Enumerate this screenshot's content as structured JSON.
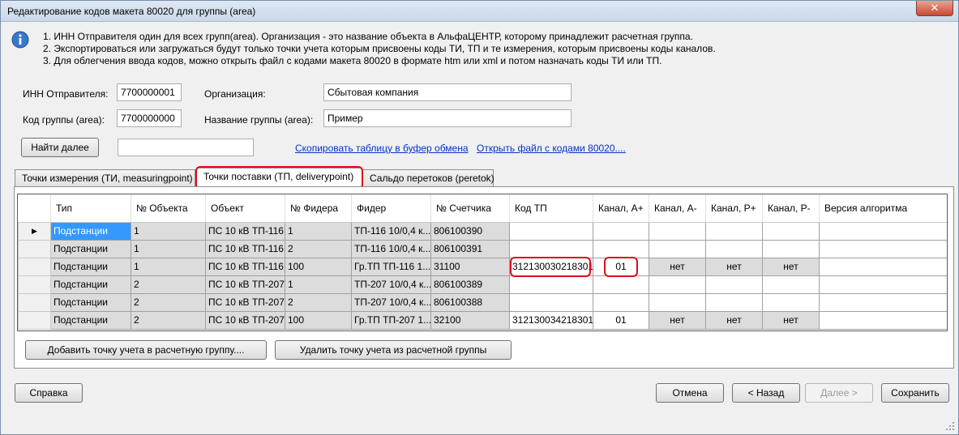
{
  "window": {
    "title": "Редактирование кодов макета 80020 для группы (area)",
    "close_label": "✕"
  },
  "info": {
    "lines": [
      "1. ИНН Отправителя один для всех групп(area). Организация - это название объекта в АльфаЦЕНТР, которому принадлежит расчетная группа.",
      "2. Экспортироваться или загружаться будут только точки учета которым присвоены коды ТИ, ТП и те измерения, которым присвоены коды каналов.",
      "3. Для облегчения ввода кодов, можно открыть файл с кодами макета 80020 в формате htm или xml и потом назначать коды ТИ или ТП."
    ]
  },
  "form": {
    "inn_label": "ИНН Отправителя:",
    "inn_value": "7700000001",
    "org_label": "Организация:",
    "org_value": "Сбытовая компания",
    "group_code_label": "Код группы (area):",
    "group_code_value": "7700000000",
    "group_name_label": "Название группы (area):",
    "group_name_value": "Пример",
    "find_next_label": "Найти далее",
    "search_value": "",
    "copy_link": "Скопировать таблицу в буфер обмена",
    "open_link": "Открыть файл с кодами 80020...."
  },
  "tabs": [
    {
      "label": "Точки измерения (ТИ, measuringpoint)",
      "active": false
    },
    {
      "label": "Точки поставки (ТП, deliverypoint)",
      "active": true
    },
    {
      "label": "Сальдо перетоков (peretok)",
      "active": false
    }
  ],
  "grid": {
    "columns": [
      "Тип",
      "№ Объекта",
      "Объект",
      "№ Фидера",
      "Фидер",
      "№ Счетчика",
      "Код ТП",
      "Канал, А+",
      "Канал, А-",
      "Канал, Р+",
      "Канал, Р-",
      "Версия алгоритма"
    ],
    "current_row_marker": "▶",
    "rows": [
      [
        "Подстанции",
        "1",
        "ПС 10 кВ ТП-116",
        "1",
        "ТП-116 10/0,4 к...",
        "806100390",
        "",
        "",
        "",
        "",
        "",
        ""
      ],
      [
        "Подстанции",
        "1",
        "ПС 10 кВ ТП-116",
        "2",
        "ТП-116 10/0,4 к...",
        "806100391",
        "",
        "",
        "",
        "",
        "",
        ""
      ],
      [
        "Подстанции",
        "1",
        "ПС 10 кВ ТП-116",
        "100",
        "Гр.ТП ТП-116 1...",
        "31100",
        "312130030218301",
        "01",
        "нет",
        "нет",
        "нет",
        ""
      ],
      [
        "Подстанции",
        "2",
        "ПС 10 кВ ТП-207",
        "1",
        "ТП-207 10/0,4 к...",
        "806100389",
        "",
        "",
        "",
        "",
        "",
        ""
      ],
      [
        "Подстанции",
        "2",
        "ПС 10 кВ ТП-207",
        "2",
        "ТП-207 10/0,4 к...",
        "806100388",
        "",
        "",
        "",
        "",
        "",
        ""
      ],
      [
        "Подстанции",
        "2",
        "ПС 10 кВ ТП-207",
        "100",
        "Гр.ТП ТП-207 1...",
        "32100",
        "312130034218301",
        "01",
        "нет",
        "нет",
        "нет",
        ""
      ]
    ]
  },
  "actions": {
    "add_point": "Добавить точку учета в расчетную группу....",
    "remove_point": "Удалить точку учета из расчетной группы"
  },
  "footer": {
    "help": "Справка",
    "cancel": "Отмена",
    "back": "< Назад",
    "next": "Далее >",
    "save": "Сохранить"
  },
  "colors": {
    "highlight": "#d9101c",
    "selection": "#3399ff",
    "link": "#0033cc"
  }
}
